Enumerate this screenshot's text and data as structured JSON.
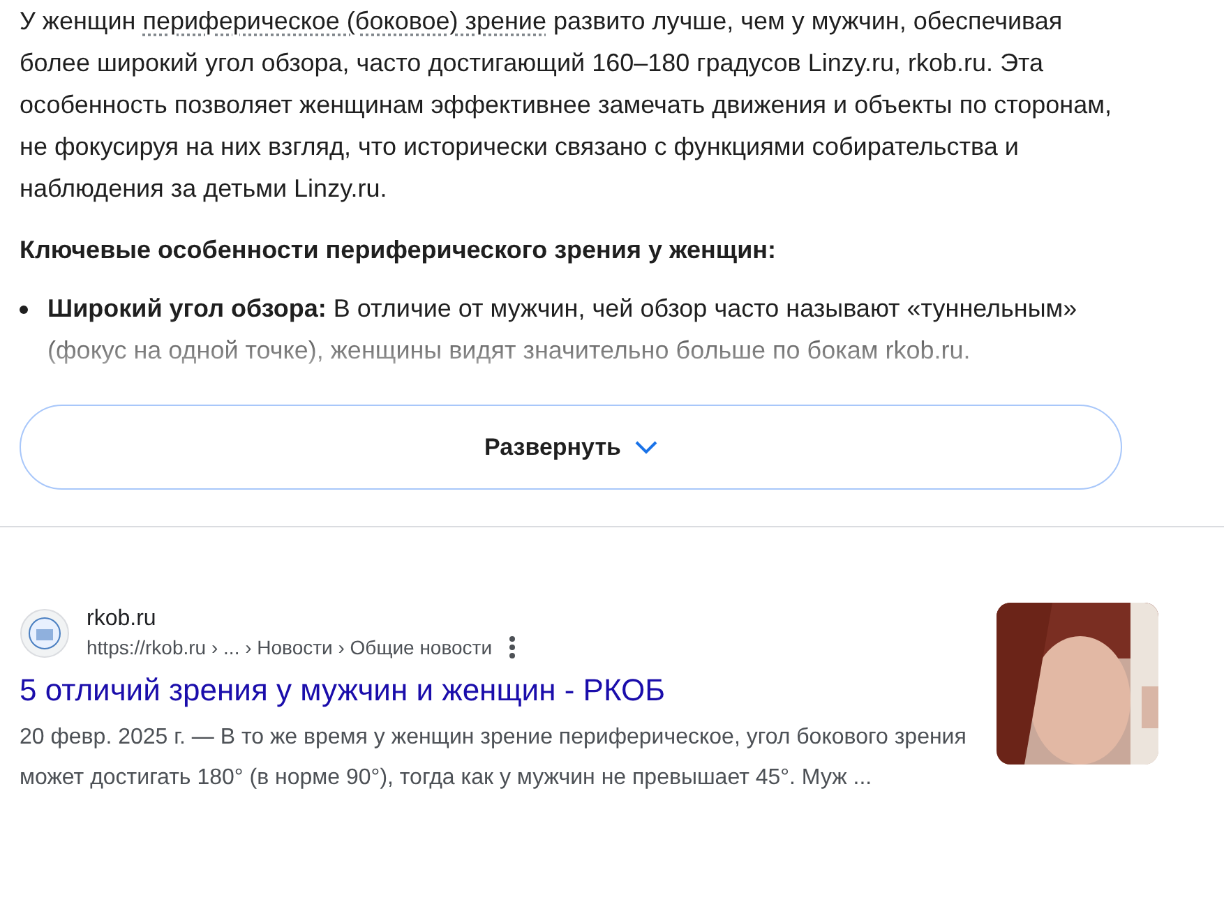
{
  "answer": {
    "paragraph": {
      "before": "У женщин ",
      "term": "периферическое (боковое) зрение",
      "after": " развито лучше, чем у мужчин, обеспечивая более широкий угол обзора, часто достигающий 160–180 градусов Linzy.ru, rkob.ru. Эта особенность позволяет женщинам эффективнее замечать движения и объекты по сторонам, не фокусируя на них взгляд, что исторически связано с функциями собирательства и наблюдения за детьми Linzy.ru."
    },
    "heading": "Ключевые особенности периферического зрения у женщин:",
    "bullets": [
      {
        "term": "Широкий угол обзора:",
        "text": " В отличие от мужчин, чей обзор часто называют «туннельным» (фокус на одной точке), женщины видят значительно больше по бокам rkob.ru."
      }
    ],
    "expand_button": "Развернуть"
  },
  "result": {
    "site": "rkob.ru",
    "url": "https://rkob.ru › ... › Новости › Общие новости",
    "title": "5 отличий зрения у мужчин и женщин - РКОБ",
    "snippet": "20 февр. 2025 г. — В то же время у женщин зрение периферическое, угол бокового зрения может достигать 180° (в норме 90°), тогда как у мужчин не превышает 45°. Муж ..."
  }
}
